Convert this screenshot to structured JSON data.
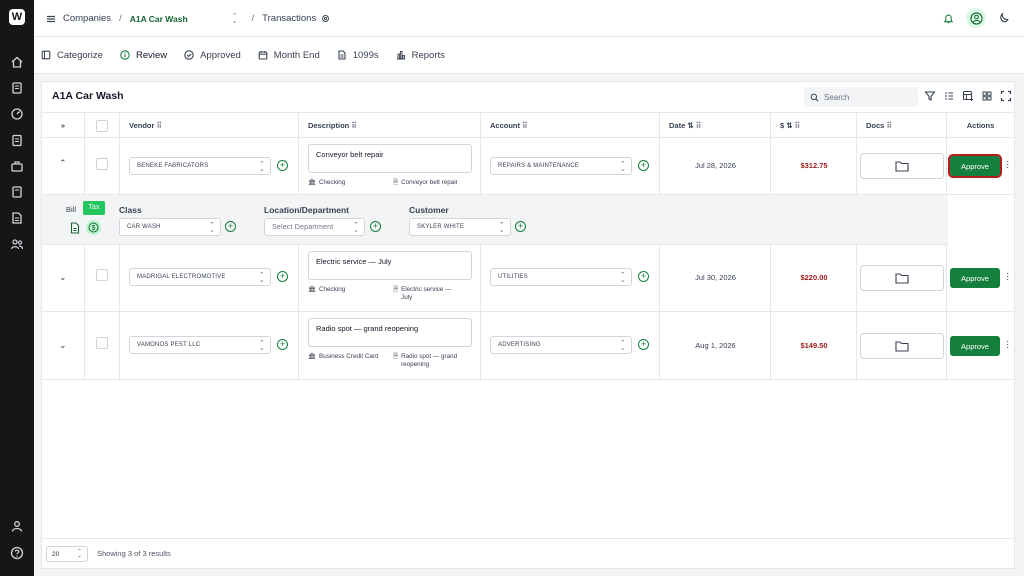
{
  "rail": {
    "logo_letter": "W",
    "icons": [
      "home-icon",
      "receipt-icon",
      "speedometer-icon",
      "clipboard-icon",
      "briefcase-icon",
      "book-icon",
      "document-icon",
      "people-icon",
      "person-icon",
      "help-icon"
    ]
  },
  "topbar": {
    "companies_label": "Companies",
    "company_name": "A1A Car Wash",
    "page_label": "Transactions"
  },
  "tabs": [
    {
      "label": "Categorize",
      "icon": "categorize-icon"
    },
    {
      "label": "Review",
      "icon": "info-icon"
    },
    {
      "label": "Approved",
      "icon": "check-circle-icon"
    },
    {
      "label": "Month End",
      "icon": "calendar-icon"
    },
    {
      "label": "1099s",
      "icon": "form-icon"
    },
    {
      "label": "Reports",
      "icon": "bar-chart-icon"
    }
  ],
  "card": {
    "title": "A1A Car Wash",
    "search_placeholder": "Search"
  },
  "columns": {
    "vendor": "Vendor",
    "description": "Description",
    "account": "Account",
    "date": "Date",
    "amount": "$",
    "docs": "Docs",
    "actions": "Actions"
  },
  "rows": [
    {
      "vendor": "BENEKE FABRICATORS",
      "description": "Conveyor belt repair",
      "source": "Checking",
      "memo": "Conveyor belt repair",
      "account": "REPAIRS & MAINTENANCE",
      "date": "Jul 28, 2026",
      "amount": "$312.75",
      "approve": "Approve"
    },
    {
      "vendor": "MADRIGAL ELECTROMOTIVE",
      "description": "Electric service — July",
      "source": "Checking",
      "memo": "Electric service — July",
      "account": "UTILITIES",
      "date": "Jul 30, 2026",
      "amount": "$220.00",
      "approve": "Approve"
    },
    {
      "vendor": "VAMONOS PEST LLC",
      "description": "Radio spot — grand reopening",
      "source": "Business Credit Card",
      "memo": "Radio spot — grand reopening",
      "account": "ADVERTISING",
      "date": "Aug 1, 2026",
      "amount": "$149.50",
      "approve": "Approve"
    }
  ],
  "expanded": {
    "bill_label": "Bill",
    "tax_tooltip": "Tax",
    "class_label": "Class",
    "class_value": "CAR WASH",
    "location_label": "Location/Department",
    "location_placeholder": "Select Department",
    "customer_label": "Customer",
    "customer_value": "SKYLER WHITE"
  },
  "footer": {
    "page_size": "20",
    "showing": "Showing 3 of 3 results"
  },
  "colors": {
    "accent": "#15803d",
    "brand_dark": "#166534",
    "amount": "#991b1b",
    "rail": "#161616",
    "focus_ring": "#b91c1c"
  }
}
